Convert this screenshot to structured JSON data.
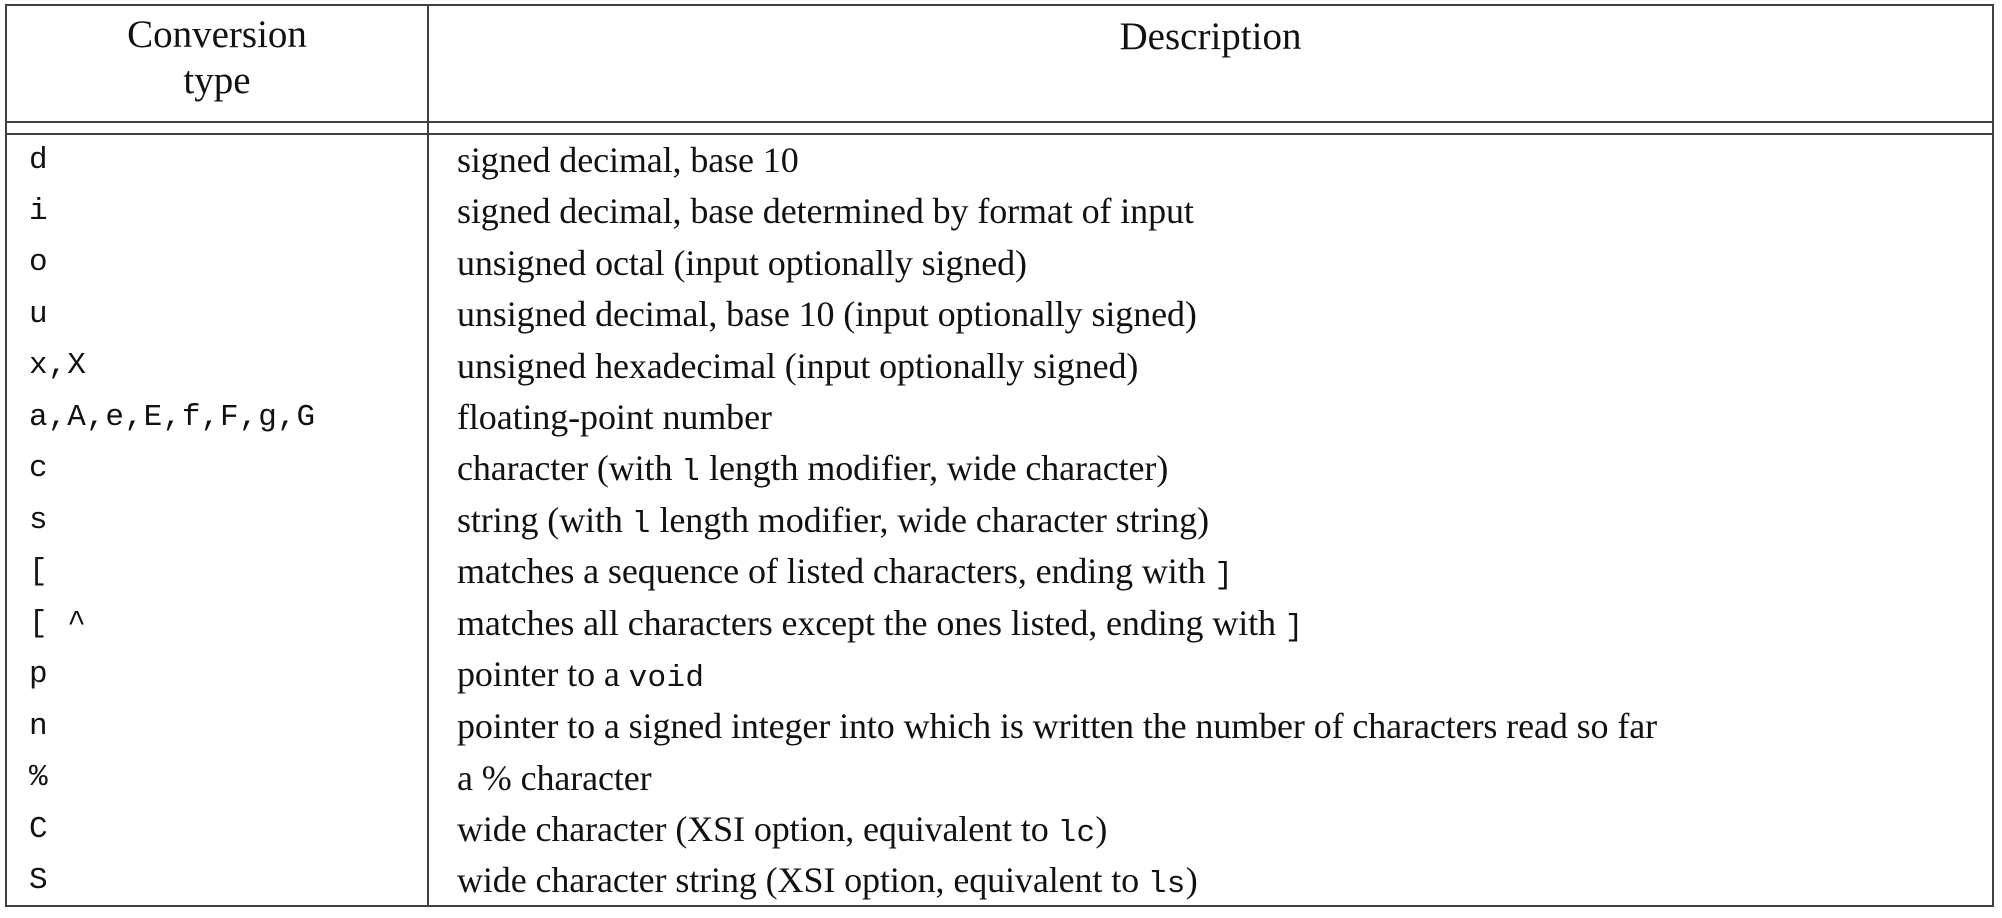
{
  "table": {
    "headers": {
      "conversion_type": "Conversion\ntype",
      "conversion_type_line1": "Conversion",
      "conversion_type_line2": "type",
      "description": "Description"
    },
    "colors": {
      "rule": "#404040",
      "text": "#111111",
      "background": "#ffffff"
    },
    "rows": [
      {
        "type": "d",
        "description": "signed decimal, base 10",
        "parts": [
          {
            "text": "signed decimal, base 10",
            "mono": false
          }
        ]
      },
      {
        "type": "i",
        "description": "signed decimal, base determined by format of input",
        "parts": [
          {
            "text": "signed decimal, base determined by format of input",
            "mono": false
          }
        ]
      },
      {
        "type": "o",
        "description": "unsigned octal (input optionally signed)",
        "parts": [
          {
            "text": "unsigned octal (input optionally signed)",
            "mono": false
          }
        ]
      },
      {
        "type": "u",
        "description": "unsigned decimal, base 10 (input optionally signed)",
        "parts": [
          {
            "text": "unsigned decimal, base 10 (input optionally signed)",
            "mono": false
          }
        ]
      },
      {
        "type": "x,X",
        "description": "unsigned hexadecimal (input optionally signed)",
        "parts": [
          {
            "text": "unsigned hexadecimal (input optionally signed)",
            "mono": false
          }
        ]
      },
      {
        "type": "a,A,e,E,f,F,g,G",
        "description": "floating-point number",
        "parts": [
          {
            "text": "floating-point number",
            "mono": false
          }
        ]
      },
      {
        "type": "c",
        "description": "character (with l length modifier, wide character)",
        "parts": [
          {
            "text": "character (with ",
            "mono": false
          },
          {
            "text": "l",
            "mono": true
          },
          {
            "text": " length modifier, wide character)",
            "mono": false
          }
        ]
      },
      {
        "type": "s",
        "description": "string (with l length modifier, wide character string)",
        "parts": [
          {
            "text": "string (with ",
            "mono": false
          },
          {
            "text": "l",
            "mono": true
          },
          {
            "text": " length modifier, wide character string)",
            "mono": false
          }
        ]
      },
      {
        "type": "[",
        "description": "matches a sequence of listed characters, ending with ]",
        "parts": [
          {
            "text": "matches a sequence of listed characters, ending with ",
            "mono": false
          },
          {
            "text": "]",
            "mono": true
          }
        ]
      },
      {
        "type": "[ ^",
        "description": "matches all characters except the ones listed, ending with ]",
        "parts": [
          {
            "text": "matches all characters except the ones listed, ending with ",
            "mono": false
          },
          {
            "text": "]",
            "mono": true
          }
        ]
      },
      {
        "type": "p",
        "description": "pointer to a void",
        "parts": [
          {
            "text": "pointer to a ",
            "mono": false
          },
          {
            "text": "void",
            "mono": true
          }
        ]
      },
      {
        "type": "n",
        "description": "pointer to a signed integer into which is written the number of characters read so far",
        "parts": [
          {
            "text": "pointer to a signed integer into which is written the number of characters read so far",
            "mono": false
          }
        ]
      },
      {
        "type": "%",
        "description": "a % character",
        "parts": [
          {
            "text": "a % character",
            "mono": false
          }
        ]
      },
      {
        "type": "C",
        "description": "wide character (XSI option, equivalent to lc)",
        "parts": [
          {
            "text": "wide character (XSI option, equivalent to ",
            "mono": false
          },
          {
            "text": "lc",
            "mono": true
          },
          {
            "text": ")",
            "mono": false
          }
        ]
      },
      {
        "type": "S",
        "description": "wide character string (XSI option, equivalent to ls)",
        "parts": [
          {
            "text": "wide character string (XSI option, equivalent to ",
            "mono": false
          },
          {
            "text": "ls",
            "mono": true
          },
          {
            "text": ")",
            "mono": false
          }
        ]
      }
    ]
  }
}
